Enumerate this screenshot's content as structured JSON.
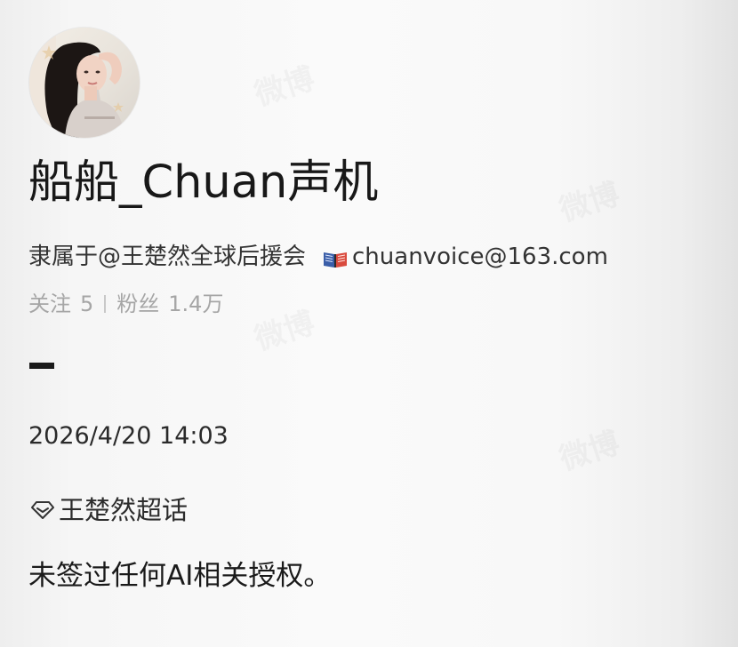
{
  "profile": {
    "name": "船船_Chuan声机",
    "bio_text": "隶属于@王楚然全球后援会",
    "email": "chuanvoice@163.com",
    "following_label": "关注",
    "following_count": "5",
    "followers_label": "粉丝",
    "followers_count": "1.4万"
  },
  "post": {
    "timestamp": "2026/4/20 14:03",
    "topic": "王楚然超话",
    "content": "未签过任何AI相关授权。"
  },
  "icons": {
    "avatar": "profile-photo",
    "email_icon": "open-book-icon",
    "topic_icon": "diamond-icon"
  }
}
